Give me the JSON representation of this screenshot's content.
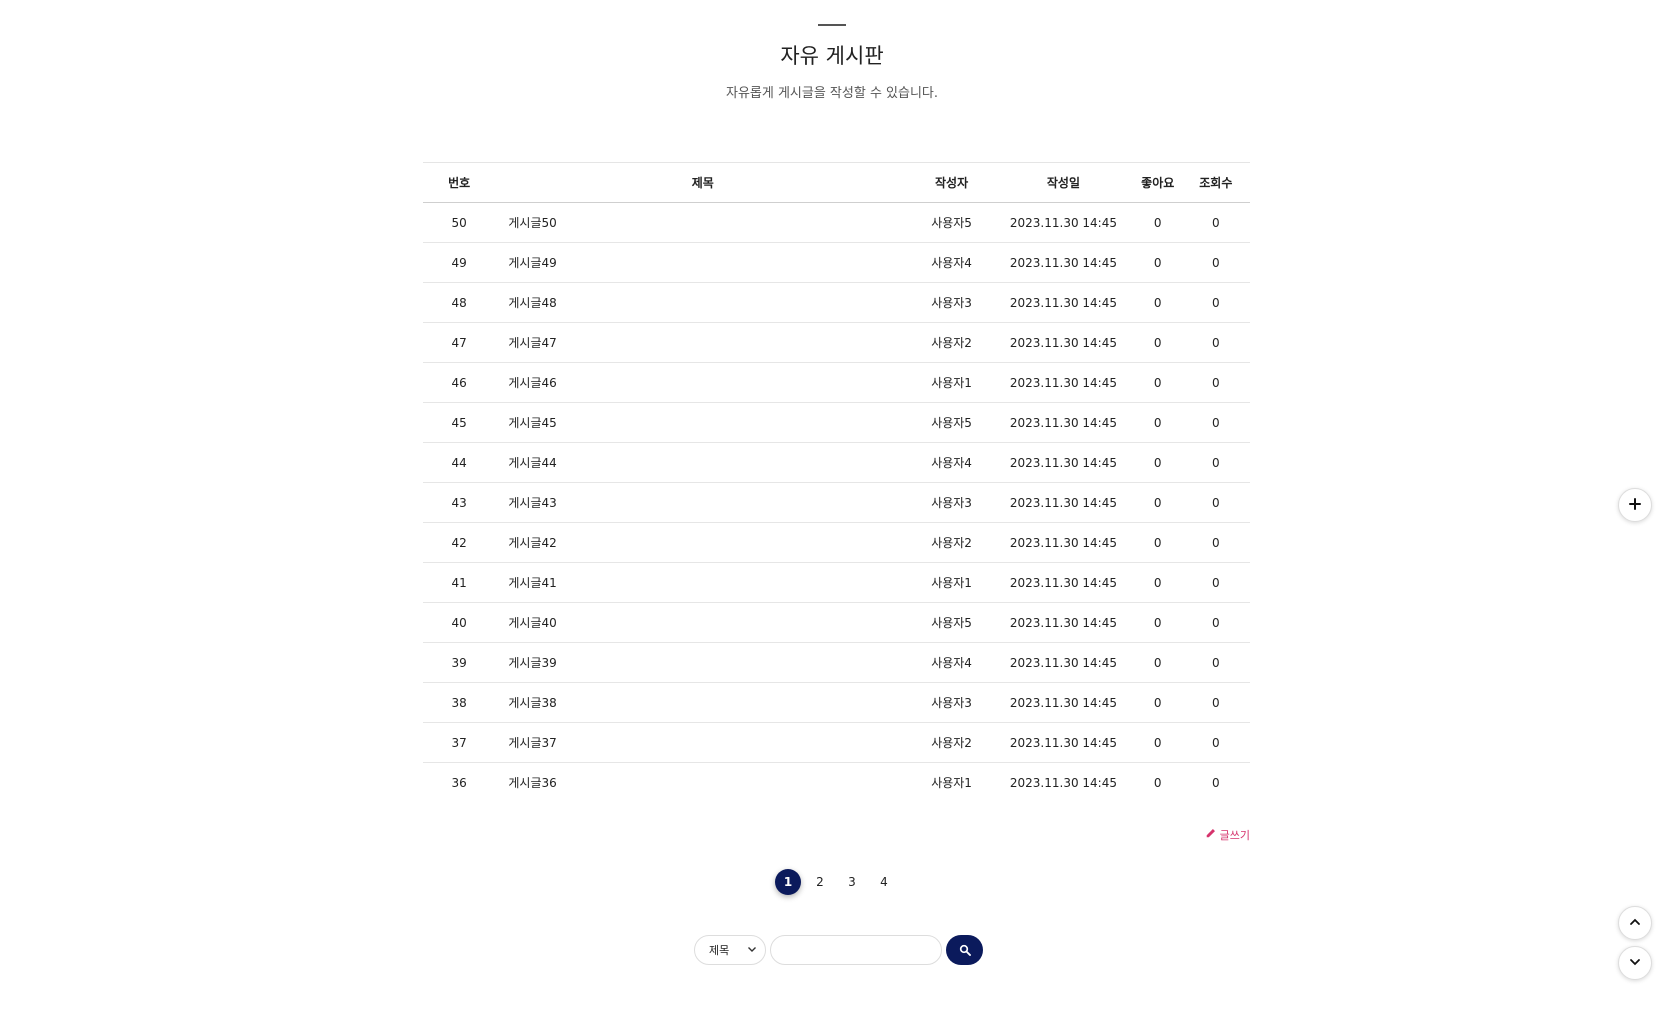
{
  "header": {
    "title": "자유 게시판",
    "subtitle": "자유롭게 게시글을 작성할 수 있습니다."
  },
  "table": {
    "columns": [
      "번호",
      "제목",
      "작성자",
      "작성일",
      "좋아요",
      "조회수"
    ],
    "rows": [
      {
        "num": "50",
        "title": "게시글50",
        "writer": "사용자5",
        "date": "2023.11.30 14:45",
        "likes": "0",
        "views": "0"
      },
      {
        "num": "49",
        "title": "게시글49",
        "writer": "사용자4",
        "date": "2023.11.30 14:45",
        "likes": "0",
        "views": "0"
      },
      {
        "num": "48",
        "title": "게시글48",
        "writer": "사용자3",
        "date": "2023.11.30 14:45",
        "likes": "0",
        "views": "0"
      },
      {
        "num": "47",
        "title": "게시글47",
        "writer": "사용자2",
        "date": "2023.11.30 14:45",
        "likes": "0",
        "views": "0"
      },
      {
        "num": "46",
        "title": "게시글46",
        "writer": "사용자1",
        "date": "2023.11.30 14:45",
        "likes": "0",
        "views": "0"
      },
      {
        "num": "45",
        "title": "게시글45",
        "writer": "사용자5",
        "date": "2023.11.30 14:45",
        "likes": "0",
        "views": "0"
      },
      {
        "num": "44",
        "title": "게시글44",
        "writer": "사용자4",
        "date": "2023.11.30 14:45",
        "likes": "0",
        "views": "0"
      },
      {
        "num": "43",
        "title": "게시글43",
        "writer": "사용자3",
        "date": "2023.11.30 14:45",
        "likes": "0",
        "views": "0"
      },
      {
        "num": "42",
        "title": "게시글42",
        "writer": "사용자2",
        "date": "2023.11.30 14:45",
        "likes": "0",
        "views": "0"
      },
      {
        "num": "41",
        "title": "게시글41",
        "writer": "사용자1",
        "date": "2023.11.30 14:45",
        "likes": "0",
        "views": "0"
      },
      {
        "num": "40",
        "title": "게시글40",
        "writer": "사용자5",
        "date": "2023.11.30 14:45",
        "likes": "0",
        "views": "0"
      },
      {
        "num": "39",
        "title": "게시글39",
        "writer": "사용자4",
        "date": "2023.11.30 14:45",
        "likes": "0",
        "views": "0"
      },
      {
        "num": "38",
        "title": "게시글38",
        "writer": "사용자3",
        "date": "2023.11.30 14:45",
        "likes": "0",
        "views": "0"
      },
      {
        "num": "37",
        "title": "게시글37",
        "writer": "사용자2",
        "date": "2023.11.30 14:45",
        "likes": "0",
        "views": "0"
      },
      {
        "num": "36",
        "title": "게시글36",
        "writer": "사용자1",
        "date": "2023.11.30 14:45",
        "likes": "0",
        "views": "0"
      }
    ]
  },
  "write_button": {
    "label": "글쓰기",
    "icon": "pencil-icon",
    "color": "#d6336c"
  },
  "pagination": {
    "pages": [
      "1",
      "2",
      "3",
      "4"
    ],
    "current": "1",
    "active_color": "#0b1a5c"
  },
  "search": {
    "field_selected": "제목",
    "query": "",
    "button_icon": "search-icon"
  },
  "floating": {
    "add_icon": "plus-icon",
    "up_icon": "chevron-up-icon",
    "down_icon": "chevron-down-icon"
  }
}
